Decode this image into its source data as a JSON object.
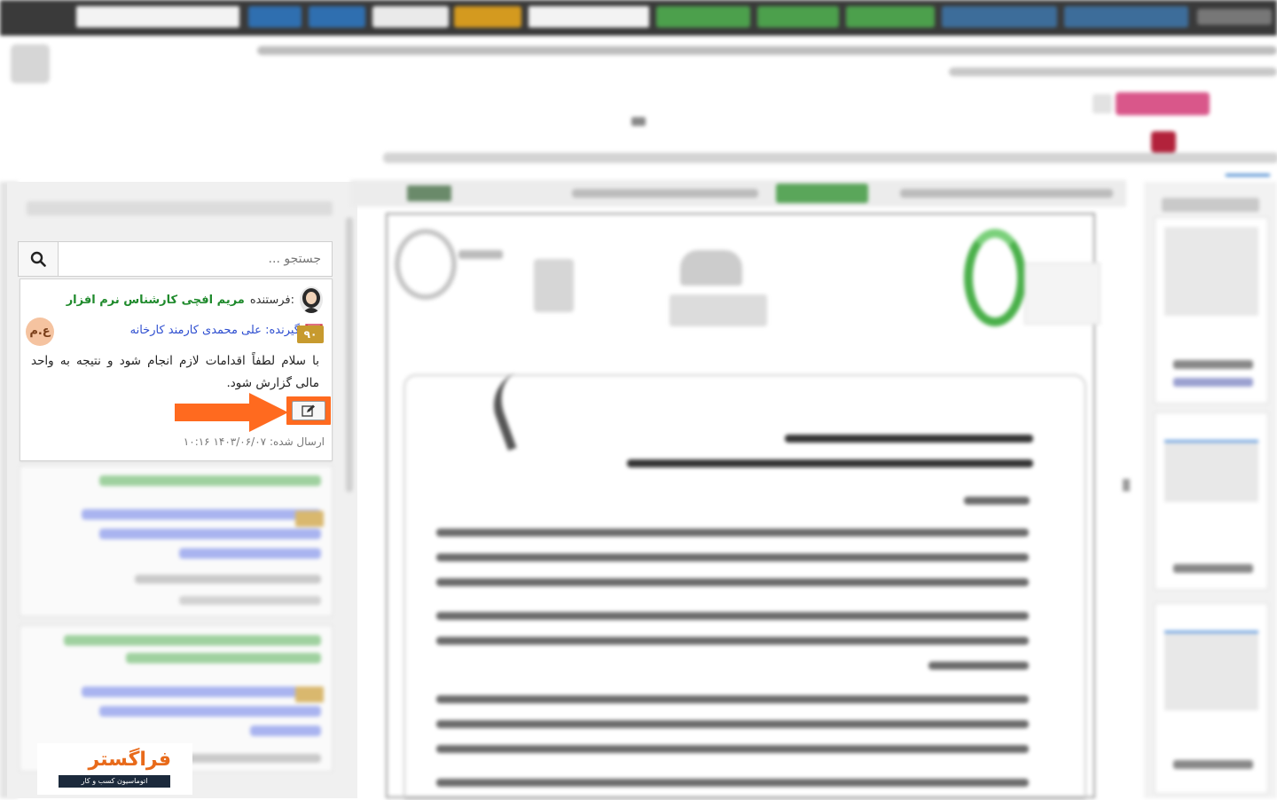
{
  "search": {
    "placeholder": "جستجو ..."
  },
  "message": {
    "sender_label": "فرستنده:",
    "sender_name": "مریم افچی کارشناس نرم افزار",
    "receiver_label": "گیرنده: علی محمدی کارمند کارخانه",
    "receiver_initials": "ع.م",
    "badge": "۹۰",
    "body": "با سلام لطفاً اقدامات لازم انجام شود و نتیجه به واحد مالی گزارش شود.",
    "sent_label": "ارسال شده:",
    "sent_value": "۱۴۰۳/۰۶/۰۷ ۱۰:۱۶"
  },
  "logo": {
    "title": "فراگستر",
    "tagline": "اتوماسیون کسب و کار"
  },
  "colors": {
    "accent_orange": "#ff6a1f",
    "sender_green": "#1f8a2c",
    "receiver_blue": "#2f4fd0",
    "badge_gold": "#c79a2e"
  }
}
